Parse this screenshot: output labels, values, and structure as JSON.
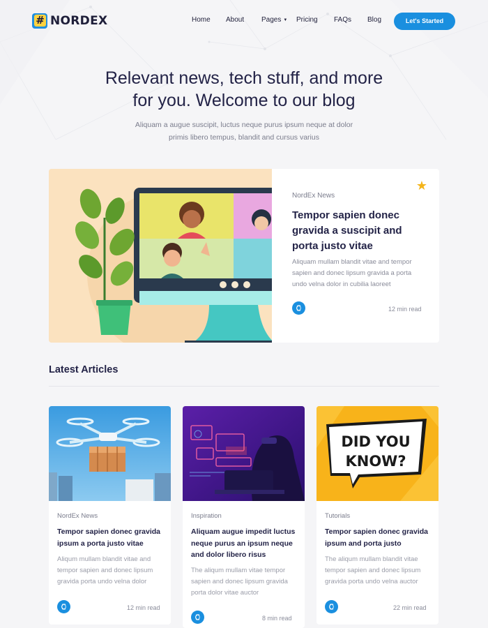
{
  "brand": {
    "name": "NORDEX",
    "mark": "#"
  },
  "nav": {
    "items": [
      "Home",
      "About",
      "Pages",
      "Pricing",
      "FAQs",
      "Blog"
    ],
    "cta": "Let's Started"
  },
  "hero": {
    "title_line1": "Relevant news, tech stuff, and more",
    "title_line2": "for you. Welcome to our blog",
    "subtitle_line1": "Aliquam a augue suscipit, luctus neque purus ipsum neque at dolor",
    "subtitle_line2": "primis libero tempus, blandit and cursus varius"
  },
  "featured": {
    "category": "NordEx News",
    "title": "Tempor sapien donec gravida a suscipit and porta justo vitae",
    "description": "Aliquam mullam blandit vitae and tempor sapien and donec lipsum gravida a porta undo velna dolor in cubilia laoreet",
    "read_time": "12 min read"
  },
  "latest": {
    "heading": "Latest Articles",
    "articles": [
      {
        "category": "NordEx News",
        "title": "Tempor sapien donec gravida ipsum a porta justo vitae",
        "description": "Aliqum mullam blandit vitae and tempor sapien and donec lipsum gravida porta undo velna dolor",
        "read_time": "12 min read"
      },
      {
        "category": "Inspiration",
        "title": "Aliquam augue impedit luctus neque purus an ipsum neque and dolor libero risus",
        "description": "The aliqum mullam vitae tempor sapien and donec lipsum gravida porta dolor vitae auctor",
        "read_time": "8 min read"
      },
      {
        "category": "Tutorials",
        "title": "Tempor sapien donec gravida ipsum and porta justo",
        "description": "The aliqum mullam blandit vitae tempor sapien and donec lipsum gravida porta undo velna auctor",
        "read_time": "22 min read"
      }
    ],
    "card3_image_text_line1": "DID YOU",
    "card3_image_text_line2": "KNOW?"
  },
  "colors": {
    "accent": "#1a8fdf",
    "star": "#f4b41a",
    "text": "#232347",
    "muted": "#7a7c8c"
  },
  "icons": {
    "star": "star-icon",
    "author": "author-avatar-icon",
    "caret": "chevron-down-icon"
  }
}
